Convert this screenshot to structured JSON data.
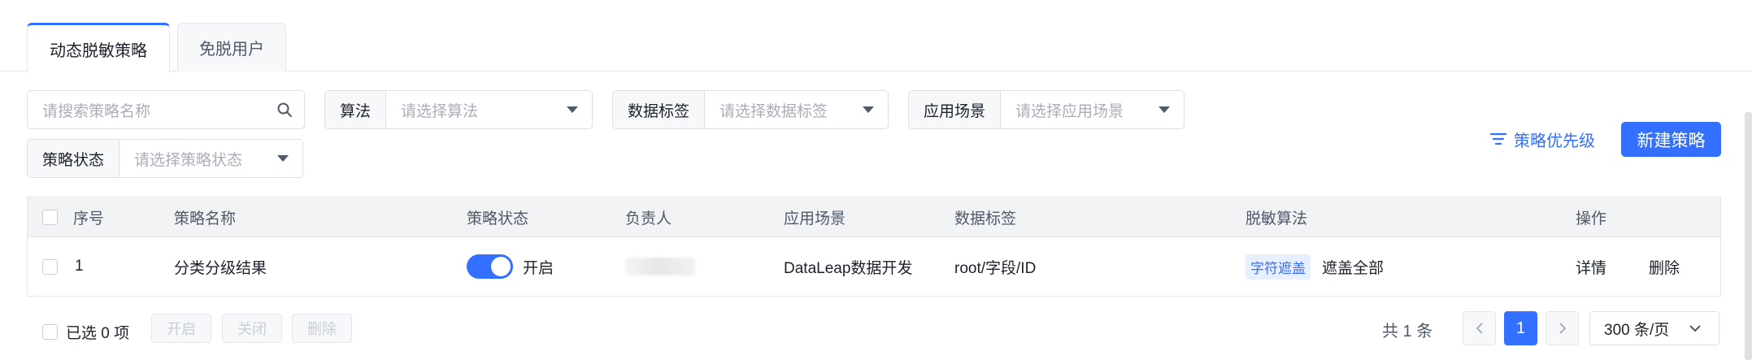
{
  "tabs": [
    {
      "label": "动态脱敏策略",
      "active": true
    },
    {
      "label": "免脱用户",
      "active": false
    }
  ],
  "filters": {
    "search_placeholder": "请搜索策略名称",
    "algo": {
      "label": "算法",
      "placeholder": "请选择算法"
    },
    "tag": {
      "label": "数据标签",
      "placeholder": "请选择数据标签"
    },
    "scene": {
      "label": "应用场景",
      "placeholder": "请选择应用场景"
    },
    "status": {
      "label": "策略状态",
      "placeholder": "请选择策略状态"
    }
  },
  "actions": {
    "priority": "策略优先级",
    "new_policy": "新建策略"
  },
  "table": {
    "headers": [
      "序号",
      "策略名称",
      "策略状态",
      "负责人",
      "应用场景",
      "数据标签",
      "脱敏算法",
      "操作"
    ],
    "rows": [
      {
        "index": "1",
        "name": "分类分级结果",
        "status": "开启",
        "status_on": true,
        "scene": "DataLeap数据开发",
        "tag": "root/字段/ID",
        "algo_type": "字符遮盖",
        "algo_desc": "遮盖全部",
        "op_detail": "详情",
        "op_delete": "删除"
      }
    ]
  },
  "footer": {
    "selected": "已选 0 项",
    "open": "开启",
    "close": "关闭",
    "delete": "删除",
    "total": "共 1 条",
    "page": "1",
    "page_size": "300 条/页"
  },
  "colors": {
    "primary": "#3370ff"
  }
}
